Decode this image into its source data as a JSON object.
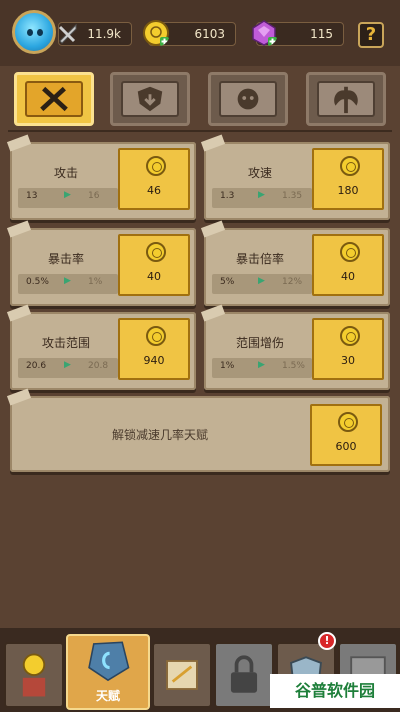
{
  "resources": [
    {
      "name": "sword-icon",
      "value": "11.9k"
    },
    {
      "name": "gold-coin-icon",
      "value": "6103"
    },
    {
      "name": "gem-icon",
      "value": "115"
    }
  ],
  "help_label": "?",
  "tabs": [
    {
      "name": "attack",
      "icon": "crossed-swords-icon",
      "active": true
    },
    {
      "name": "defense",
      "icon": "shield-icon",
      "active": false
    },
    {
      "name": "minion",
      "icon": "face-icon",
      "active": false
    },
    {
      "name": "special",
      "icon": "axe-icon",
      "active": false
    }
  ],
  "cards": [
    {
      "name": "攻击",
      "from": "13",
      "to": "16",
      "cost": "46"
    },
    {
      "name": "攻速",
      "from": "1.3",
      "to": "1.35",
      "cost": "180"
    },
    {
      "name": "暴击率",
      "from": "0.5%",
      "to": "1%",
      "cost": "40"
    },
    {
      "name": "暴击倍率",
      "from": "5%",
      "to": "12%",
      "cost": "40"
    },
    {
      "name": "攻击范围",
      "from": "20.6",
      "to": "20.8",
      "cost": "940"
    },
    {
      "name": "范围增伤",
      "from": "1%",
      "to": "1.5%",
      "cost": "30"
    }
  ],
  "unlock": {
    "label": "解锁减速几率天赋",
    "cost": "600"
  },
  "nav": {
    "talent_label": "天赋",
    "badge": "!",
    "watermark": "谷普软件园"
  },
  "colors": {
    "accent": "#f0c444",
    "background": "#5a4232",
    "arrow": "#39a572"
  }
}
